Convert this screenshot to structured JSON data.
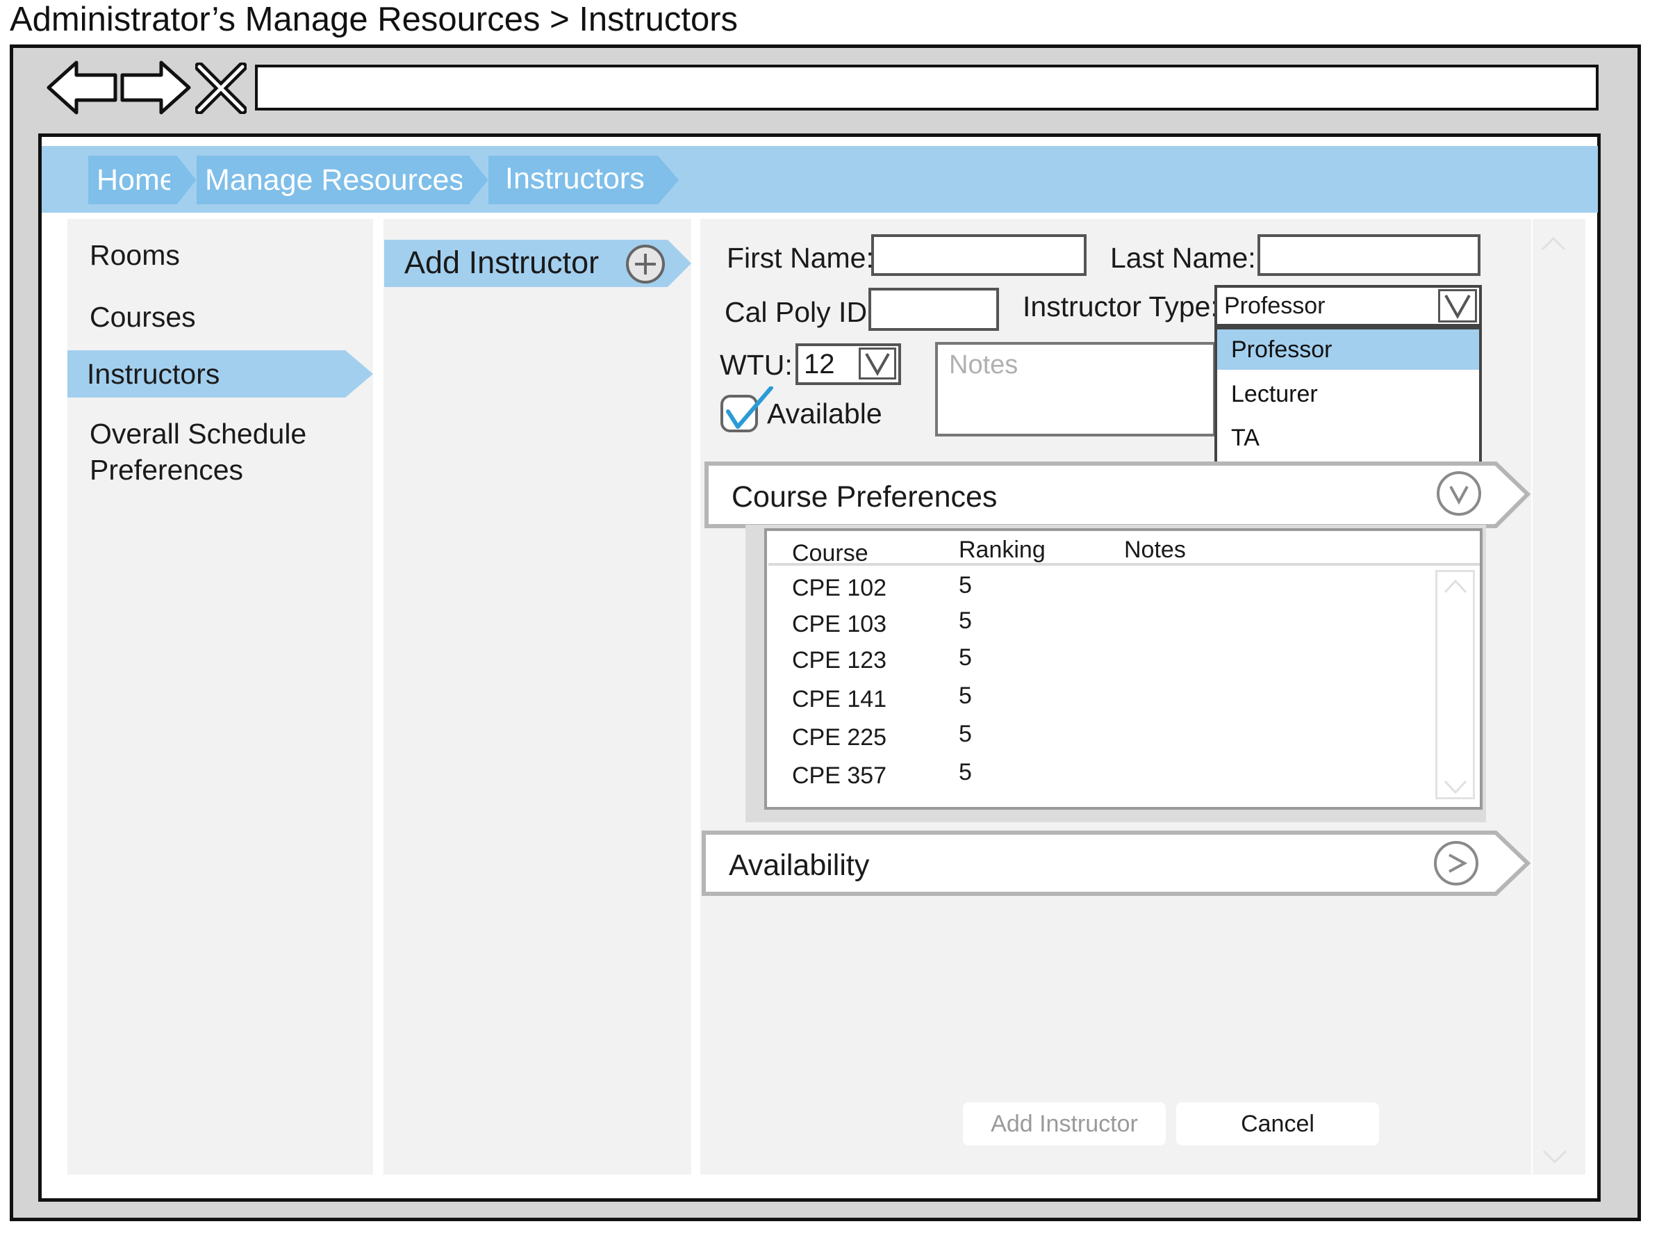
{
  "page_title": "Administrator’s Manage Resources > Instructors",
  "breadcrumb": [
    "Home",
    "Manage Resources",
    "Instructors"
  ],
  "left_nav": {
    "items": [
      "Rooms",
      "Courses",
      "Instructors"
    ],
    "schedule_line1": "Overall Schedule",
    "schedule_line2": "Preferences",
    "active": "Instructors"
  },
  "middle": {
    "add_instructor_label": "Add Instructor"
  },
  "form": {
    "first_name_label": "First Name:",
    "first_name_value": "",
    "last_name_label": "Last Name:",
    "last_name_value": "",
    "cal_poly_id_label": "Cal Poly ID:",
    "cal_poly_id_value": "",
    "instructor_type_label": "Instructor Type:",
    "instructor_type_value": "Professor",
    "instructor_type_options": [
      "Professor",
      "Lecturer",
      "TA"
    ],
    "wtu_label": "WTU:",
    "wtu_value": "12",
    "available_label": "Available",
    "available_checked": true,
    "notes_placeholder": "Notes"
  },
  "course_preferences": {
    "title": "Course Preferences",
    "columns": [
      "Course",
      "Ranking",
      "Notes"
    ],
    "rows": [
      {
        "course": "CPE 102",
        "ranking": "5",
        "notes": ""
      },
      {
        "course": "CPE 103",
        "ranking": "5",
        "notes": ""
      },
      {
        "course": "CPE 123",
        "ranking": "5",
        "notes": ""
      },
      {
        "course": "CPE 141",
        "ranking": "5",
        "notes": ""
      },
      {
        "course": "CPE 225",
        "ranking": "5",
        "notes": ""
      },
      {
        "course": "CPE 357",
        "ranking": "5",
        "notes": ""
      }
    ]
  },
  "availability": {
    "title": "Availability"
  },
  "buttons": {
    "add_instructor": "Add Instructor",
    "cancel": "Cancel"
  },
  "colors": {
    "accent": "#7fbfe9",
    "accent_light": "#a3cfee",
    "panel": "#f2f2f2",
    "check": "#2a9bd6"
  }
}
